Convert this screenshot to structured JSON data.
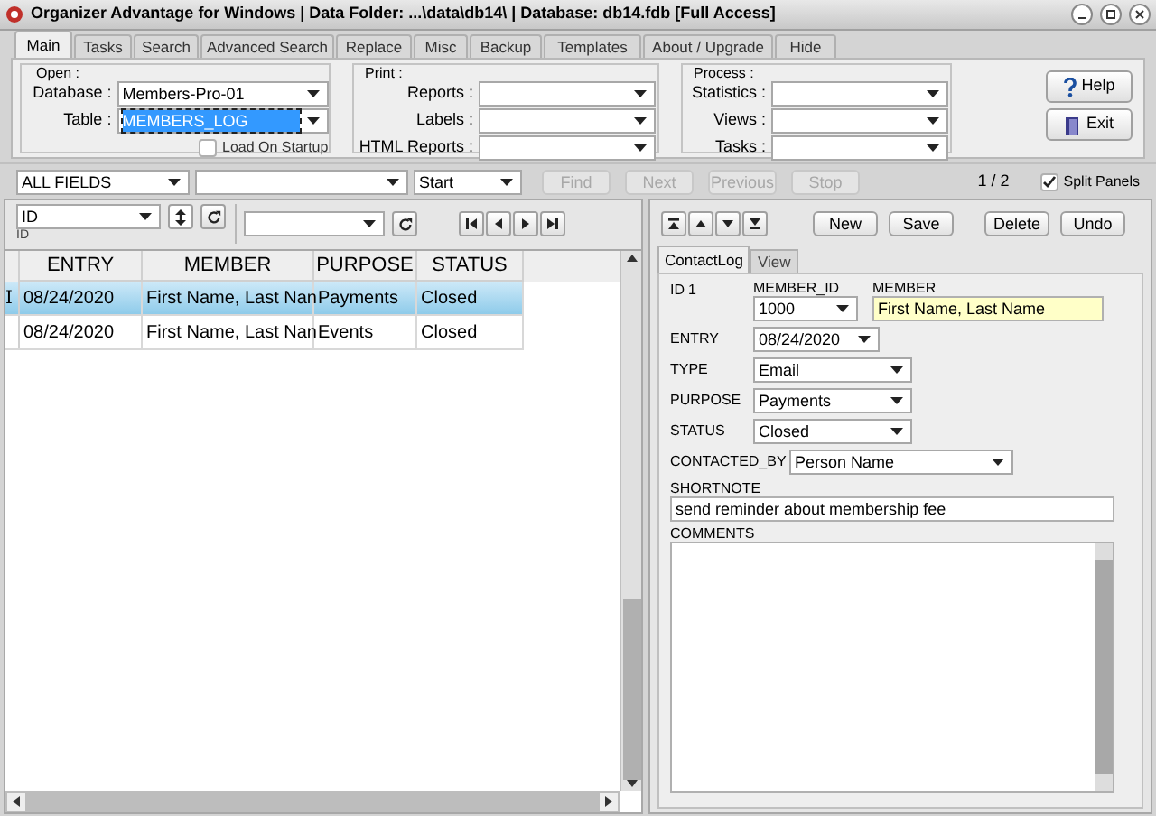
{
  "window": {
    "title": "Organizer Advantage for Windows | Data Folder: ...\\data\\db14\\ | Database: db14.fdb [Full Access]"
  },
  "tabs": [
    {
      "label": "Main",
      "selected": true
    },
    {
      "label": "Tasks",
      "selected": false
    },
    {
      "label": "Search",
      "selected": false
    },
    {
      "label": "Advanced Search",
      "selected": false
    },
    {
      "label": "Replace",
      "selected": false
    },
    {
      "label": "Misc",
      "selected": false
    },
    {
      "label": "Backup",
      "selected": false
    },
    {
      "label": "Templates",
      "selected": false
    },
    {
      "label": "About / Upgrade",
      "selected": false
    },
    {
      "label": "Hide",
      "selected": false
    }
  ],
  "open": {
    "legend": "Open :",
    "database_label": "Database :",
    "database": "Members-Pro-01",
    "table_label": "Table :",
    "table": "MEMBERS_LOG",
    "table_focused": true,
    "load_on_startup": {
      "label": "Load On Startup",
      "checked": false
    }
  },
  "print": {
    "legend": "Print :",
    "fields": [
      {
        "label": "Reports :"
      },
      {
        "label": "Labels :"
      },
      {
        "label": "HTML Reports :"
      }
    ]
  },
  "process": {
    "legend": "Process :",
    "fields": [
      {
        "label": "Statistics :"
      },
      {
        "label": "Views :"
      },
      {
        "label": "Tasks :"
      }
    ]
  },
  "side_buttons": [
    {
      "kind": "help",
      "label": "Help"
    },
    {
      "kind": "exit",
      "label": "Exit"
    }
  ],
  "search": {
    "field": "ALL FIELDS",
    "mode": "Start",
    "buttons": [
      {
        "label": "Find",
        "disabled": true
      },
      {
        "label": "Next",
        "disabled": true
      },
      {
        "label": "Previous",
        "disabled": true
      },
      {
        "label": "Stop",
        "disabled": true
      }
    ],
    "record_count": "1 / 2",
    "split_panels": {
      "label": "Split Panels",
      "checked": true
    }
  },
  "sort": {
    "field": "ID",
    "caption": "ID"
  },
  "grid": {
    "columns": [
      "ENTRY",
      "MEMBER",
      "PURPOSE",
      "STATUS"
    ],
    "rows": [
      {
        "indicator": "I",
        "selected": true,
        "cells": [
          "08/24/2020",
          "First Name, Last Nan",
          "Payments",
          "Closed"
        ]
      },
      {
        "indicator": "",
        "selected": false,
        "cells": [
          "08/24/2020",
          "First Name, Last Nan",
          "Events",
          "Closed"
        ]
      }
    ]
  },
  "record_buttons": [
    "New",
    "Save",
    "Delete",
    "Undo"
  ],
  "form_tabs": [
    {
      "label": "ContactLog",
      "selected": true
    },
    {
      "label": "View",
      "selected": false
    }
  ],
  "form": {
    "id_label": "ID",
    "id": "1",
    "member_id_label": "MEMBER_ID",
    "member_id": "1000",
    "member_label": "MEMBER",
    "member": "First Name, Last Name",
    "fields": [
      {
        "label": "ENTRY",
        "value": "08/24/2020"
      },
      {
        "label": "TYPE",
        "value": "Email"
      },
      {
        "label": "PURPOSE",
        "value": "Payments"
      },
      {
        "label": "STATUS",
        "value": "Closed"
      },
      {
        "label": "CONTACTED_BY",
        "value": "Person Name"
      }
    ],
    "shortnote_label": "SHORTNOTE",
    "shortnote": "send reminder about membership fee",
    "comments_label": "COMMENTS"
  }
}
